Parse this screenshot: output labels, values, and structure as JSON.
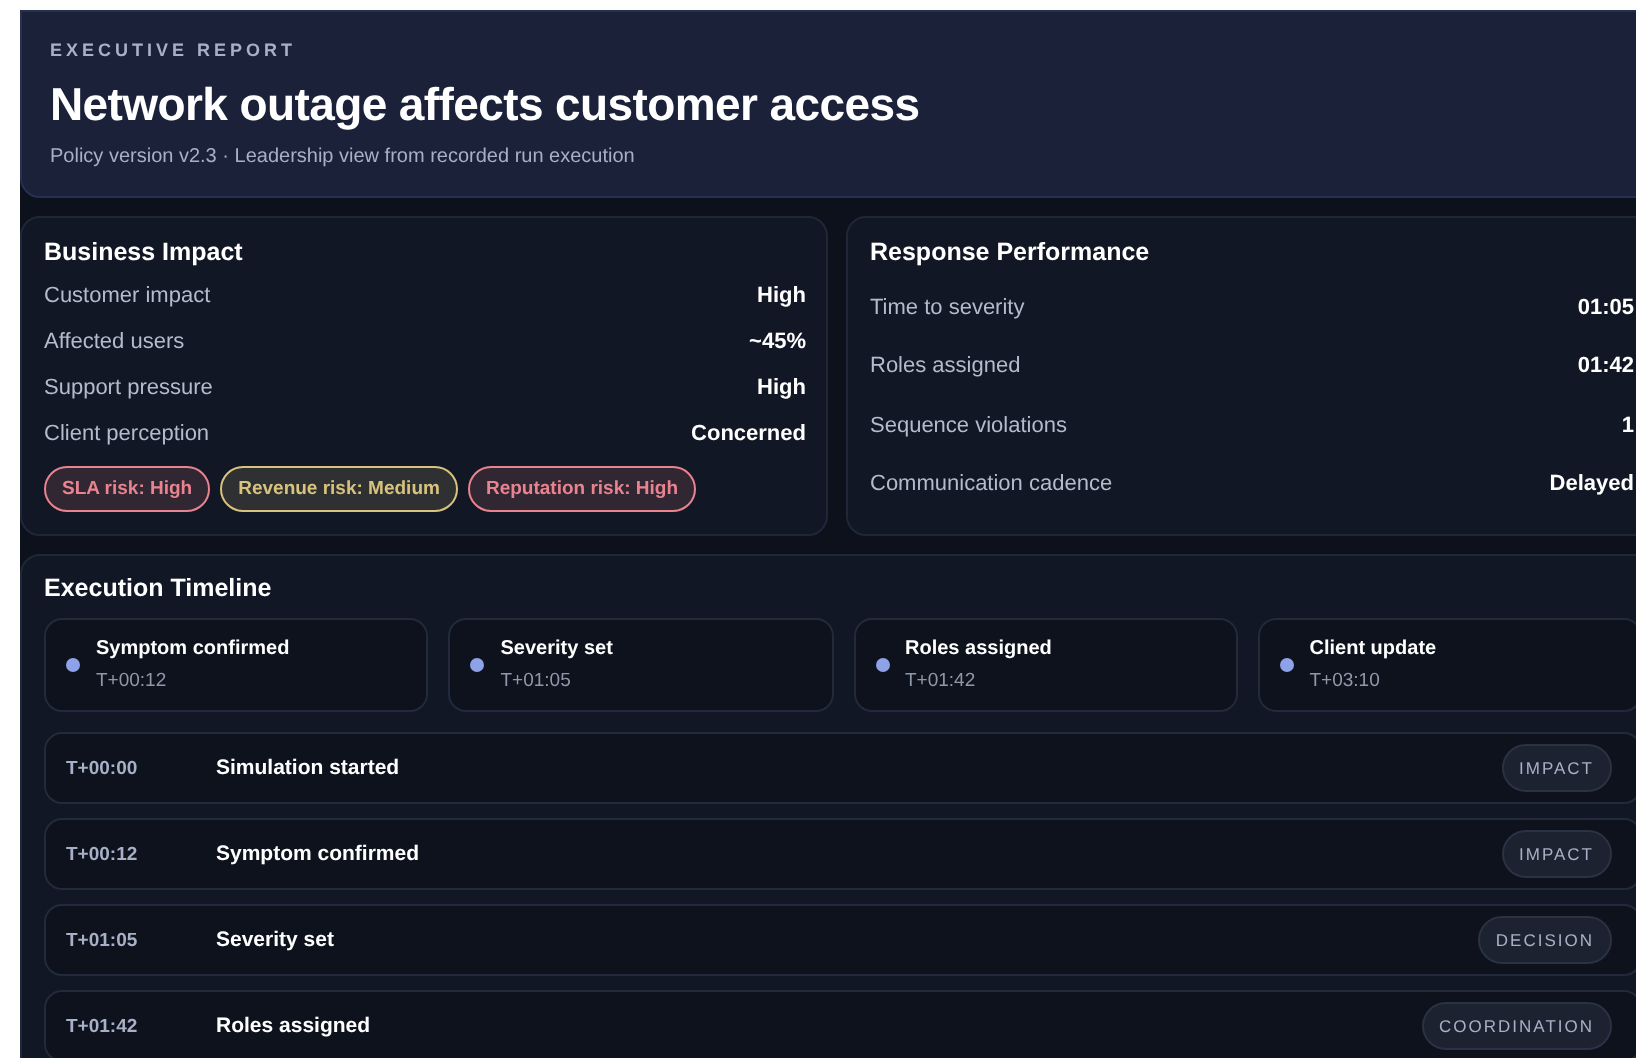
{
  "header": {
    "eyebrow": "EXECUTIVE REPORT",
    "title": "Network outage affects customer access",
    "subtitle": "Policy version v2.3 · Leadership view from recorded run execution"
  },
  "business_impact": {
    "title": "Business Impact",
    "rows": [
      {
        "label": "Customer impact",
        "value": "High"
      },
      {
        "label": "Affected users",
        "value": "~45%"
      },
      {
        "label": "Support pressure",
        "value": "High"
      },
      {
        "label": "Client perception",
        "value": "Concerned"
      }
    ],
    "risks": [
      {
        "label": "SLA risk: High",
        "color": "#e8838f"
      },
      {
        "label": "Revenue risk: Medium",
        "color": "#d8c27e"
      },
      {
        "label": "Reputation risk: High",
        "color": "#e8838f"
      }
    ]
  },
  "response_performance": {
    "title": "Response Performance",
    "rows": [
      {
        "label": "Time to severity",
        "value": "01:05"
      },
      {
        "label": "Roles assigned",
        "value": "01:42"
      },
      {
        "label": "Sequence violations",
        "value": "1"
      },
      {
        "label": "Communication cadence",
        "value": "Delayed"
      }
    ]
  },
  "timeline": {
    "title": "Execution Timeline",
    "milestones": [
      {
        "label": "Symptom confirmed",
        "time": "T+00:12"
      },
      {
        "label": "Severity set",
        "time": "T+01:05"
      },
      {
        "label": "Roles assigned",
        "time": "T+01:42"
      },
      {
        "label": "Client update",
        "time": "T+03:10"
      }
    ],
    "events": [
      {
        "time": "T+00:00",
        "label": "Simulation started",
        "tag": "IMPACT"
      },
      {
        "time": "T+00:12",
        "label": "Symptom confirmed",
        "tag": "IMPACT"
      },
      {
        "time": "T+01:05",
        "label": "Severity set",
        "tag": "DECISION"
      },
      {
        "time": "T+01:42",
        "label": "Roles assigned",
        "tag": "COORDINATION"
      }
    ]
  }
}
